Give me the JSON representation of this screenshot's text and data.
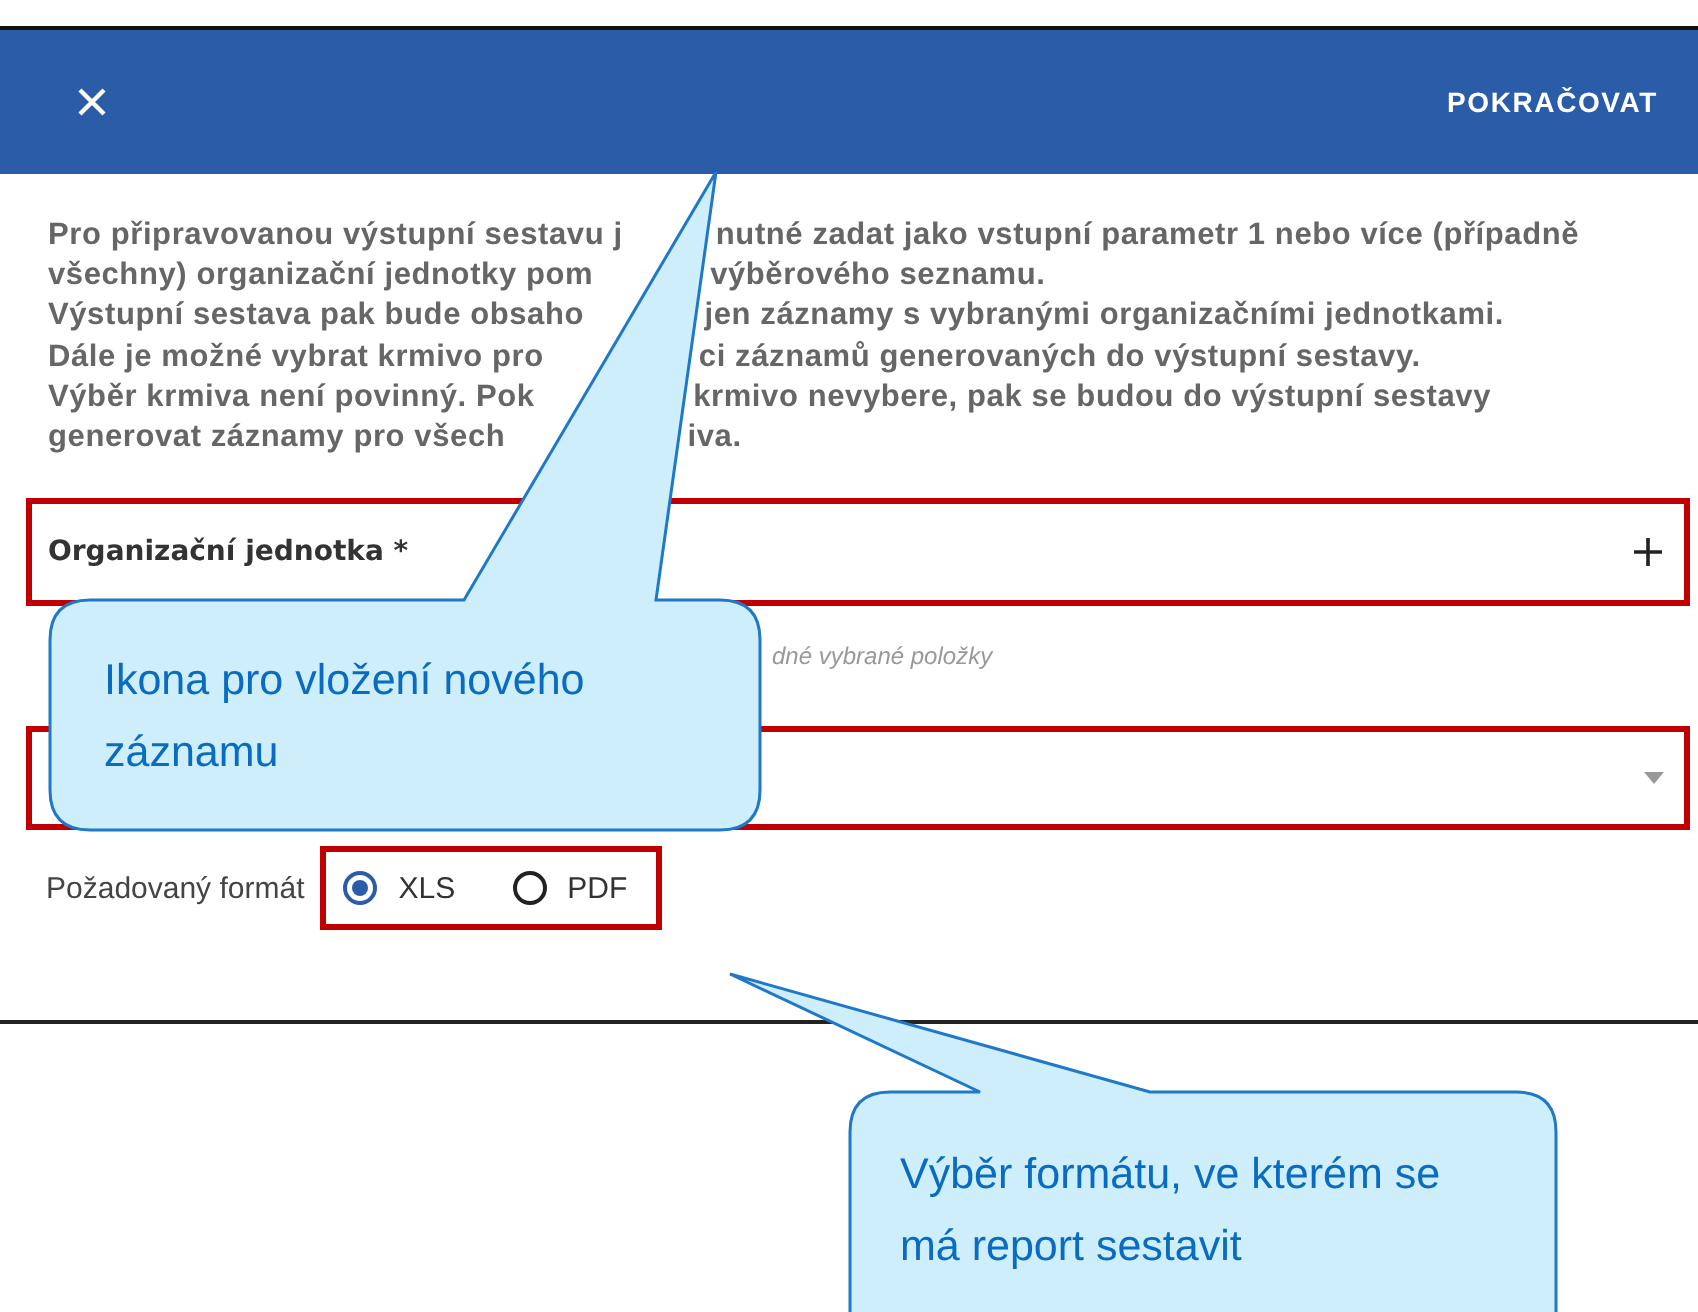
{
  "header": {
    "action": "POKRAČOVAT"
  },
  "intro_lines": [
    {
      "segments": [
        "Pro připravovanou výstupní sestavu j",
        "nutné zadat jako vstupní parametr 1 nebo více (případně"
      ]
    },
    {
      "segments": [
        "všechny) organizační jednotky pom",
        "výběrového seznamu."
      ]
    },
    {
      "segments": [
        "Výstupní sestava pak bude obsaho",
        "jen záznamy s vybranými organizačními jednotkami."
      ]
    },
    {
      "segments": [
        "Dále je možné vybrat krmivo pro",
        "ci záznamů generovaných do výstupní sestavy."
      ]
    },
    {
      "segments": [
        "Výběr krmiva není povinný. Pok",
        "krmivo nevybere, pak se budou do výstupní sestavy"
      ]
    },
    {
      "segments": [
        "generovat záznamy pro všech",
        "iva."
      ]
    }
  ],
  "org_field": {
    "label": "Organizační jednotka *",
    "hint": "dné vybrané položky"
  },
  "format": {
    "label": "Požadovaný formát",
    "options": [
      {
        "label": "XLS",
        "selected": true
      },
      {
        "label": "PDF",
        "selected": false
      }
    ]
  },
  "callouts": [
    {
      "text": "Ikona pro vložení nového záznamu"
    },
    {
      "text": "Výběr formátu, ve kterém se má report sestavit"
    }
  ]
}
